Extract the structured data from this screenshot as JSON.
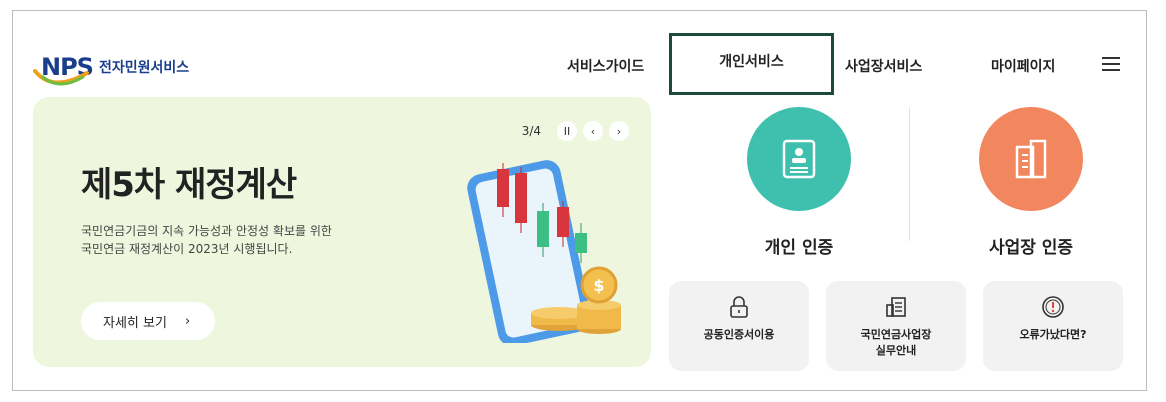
{
  "logo": {
    "mark": "NPS",
    "text": "전자민원서비스"
  },
  "nav": {
    "items": [
      "서비스가이드",
      "개인서비스",
      "사업장서비스",
      "마이페이지"
    ],
    "active_index": 1
  },
  "banner": {
    "pager_text": "3/4",
    "title": "제5차 재정계산",
    "desc_line1": "국민연금기금의 지속 가능성과 안정성 확보를 위한",
    "desc_line2": "국민연금 재정계산이 2023년 시행됩니다.",
    "more_label": "자세히 보기",
    "bg_color": "#eef7de"
  },
  "auth": {
    "personal_label": "개인 인증",
    "business_label": "사업장 인증",
    "personal_color": "#3fbfae",
    "business_color": "#f2865e"
  },
  "quick": [
    {
      "label_line1": "공동인증서이용",
      "label_line2": "",
      "icon": "lock-icon"
    },
    {
      "label_line1": "국민연금사업장",
      "label_line2": "실무안내",
      "icon": "document-icon"
    },
    {
      "label_line1": "오류가났다면?",
      "label_line2": "",
      "icon": "alert-icon"
    }
  ]
}
